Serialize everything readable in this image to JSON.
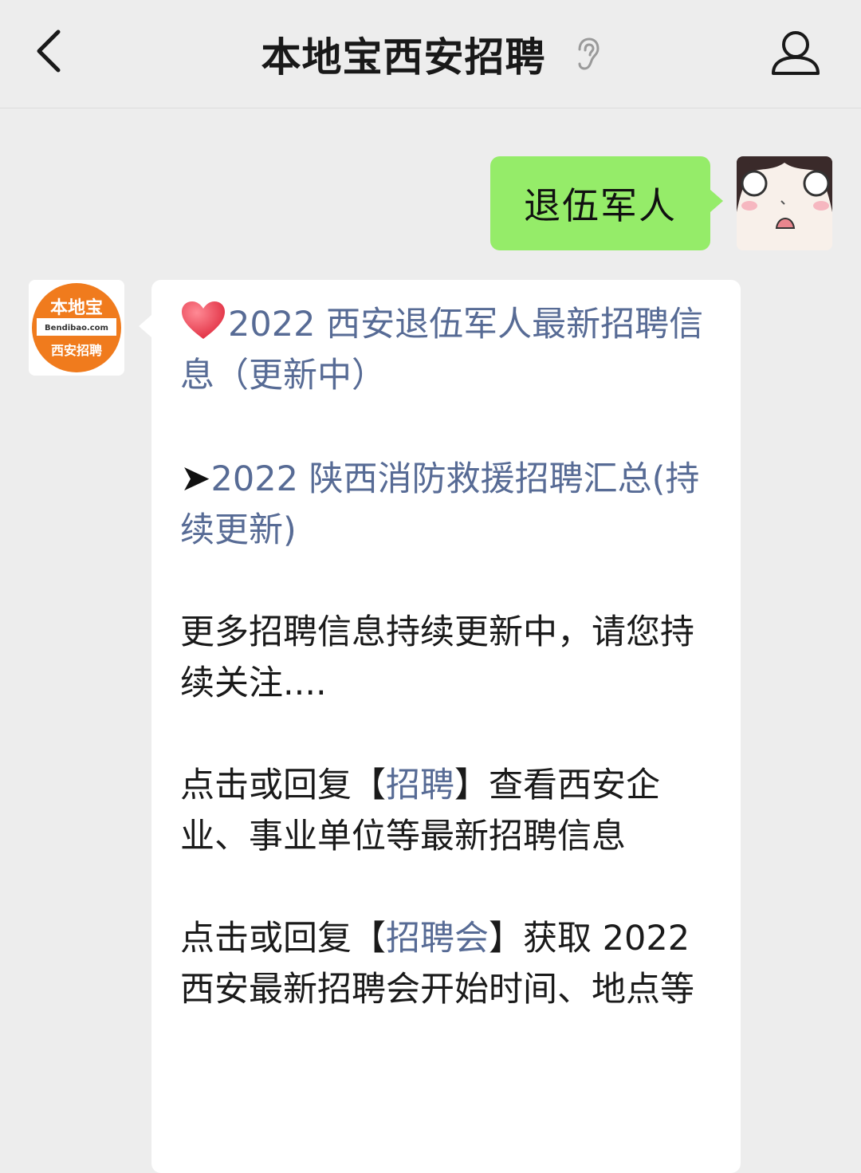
{
  "header": {
    "title": "本地宝西安招聘",
    "back_icon": "chevron-left-icon",
    "voice_icon": "ear-icon",
    "profile_icon": "person-icon"
  },
  "messages": {
    "sent": {
      "text": "退伍军人"
    },
    "received": {
      "logo": {
        "brand": "本地宝",
        "domain": "Bendibao.com",
        "sub": "西安招聘"
      },
      "link1_prefix": "2022",
      "link1_text": "西安退伍军人最新招聘信息（更新中）",
      "link2_arrow": "➤",
      "link2_text": "2022 陕西消防救援招聘汇总(持续更新)",
      "para3": "更多招聘信息持续更新中，请您持续关注....",
      "para4_a": "点击或回复【",
      "para4_link": "招聘",
      "para4_b": "】查看西安企业、事业单位等最新招聘信息",
      "para5_a": "点击或回复【",
      "para5_link": "招聘会",
      "para5_b": "】获取 2022 西安最新招聘会开始时间、地点等"
    }
  },
  "colors": {
    "background": "#ededed",
    "sent_bubble": "#95ec69",
    "received_bubble": "#ffffff",
    "link": "#576b95",
    "brand_orange": "#f07b1d"
  }
}
